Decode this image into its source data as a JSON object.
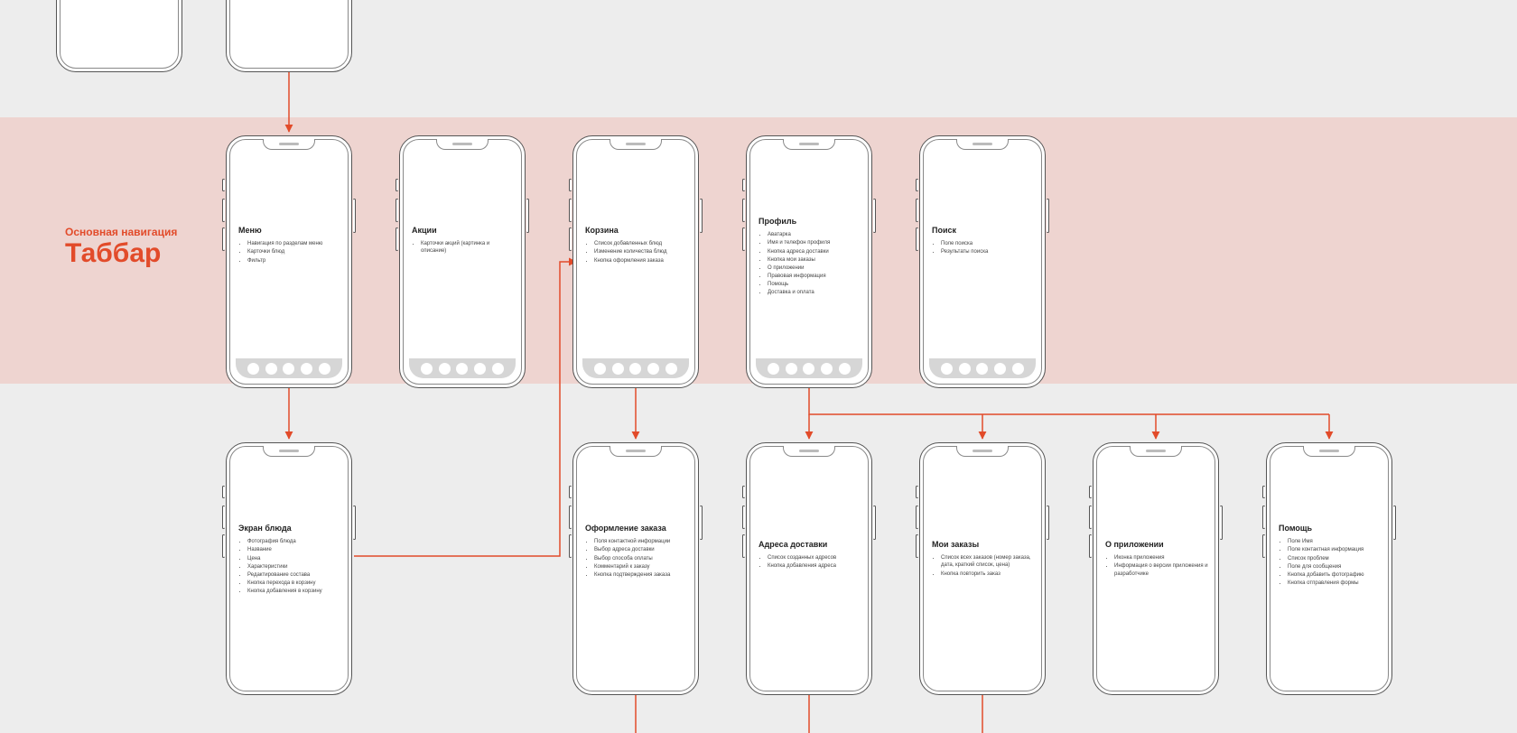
{
  "section": {
    "subtitle": "Основная навигация",
    "title": "Таббар"
  },
  "screens": {
    "menu": {
      "title": "Меню",
      "items": [
        "Навигация по разделам меню",
        "Карточки блюд",
        "Фильтр"
      ]
    },
    "promo": {
      "title": "Акции",
      "items": [
        "Карточки акций (картинка и описание)"
      ]
    },
    "cart": {
      "title": "Корзина",
      "items": [
        "Список добавленных блюд",
        "Изменение количества блюд",
        "Кнопка оформления заказа"
      ]
    },
    "profile": {
      "title": "Профиль",
      "items": [
        "Аватарка",
        "Имя и телефон профиля",
        "Кнопка адреса доставки",
        "Кнопка мои заказы",
        "О приложении",
        "Правовая информация",
        "Помощь",
        "Доставка и оплата"
      ]
    },
    "search": {
      "title": "Поиск",
      "items": [
        "Поле поиска",
        "Результаты поиска"
      ]
    },
    "dish": {
      "title": "Экран блюда",
      "items": [
        "Фотография блюда",
        "Название",
        "Цена",
        "Характеристики",
        "Редактирование состава",
        "Кнопка перехода в корзину",
        "Кнопка добавления в корзину"
      ]
    },
    "checkout": {
      "title": "Оформление заказа",
      "items": [
        "Поля контактной информации",
        "Выбор адреса доставки",
        "Выбор способа оплаты",
        "Комментарий к заказу",
        "Кнопка подтверждения заказа"
      ]
    },
    "addresses": {
      "title": "Адреса доставки",
      "items": [
        "Список созданных адресов",
        "Кнопка добавления адреса"
      ]
    },
    "orders": {
      "title": "Мои заказы",
      "items": [
        "Список всех заказов (номер заказа, дата, краткий список, цена)",
        "Кнопка повторить заказ"
      ]
    },
    "about": {
      "title": "О приложении",
      "items": [
        "Иконка приложения",
        "Информация о версии приложения и разработчике"
      ]
    },
    "help": {
      "title": "Помощь",
      "items": [
        "Поле Имя",
        "Поле контактная информация",
        "Список проблем",
        "Поле для сообщения",
        "Кнопка добавить фотографию",
        "Кнопка отправления формы"
      ]
    }
  },
  "colors": {
    "accent": "#e24b2a",
    "band": "#eed4d0",
    "bg": "#ededed"
  }
}
